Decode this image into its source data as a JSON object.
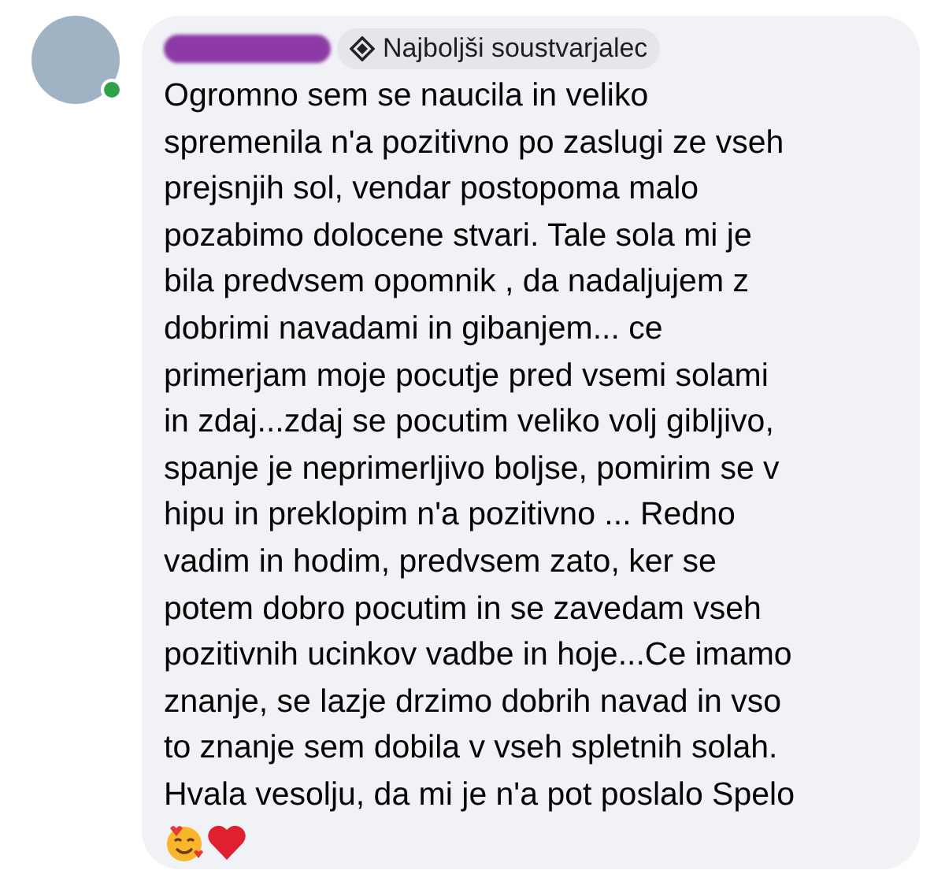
{
  "comment": {
    "author_badge": "Najboljši soustvarjalec",
    "online": true,
    "lines": [
      "Ogromno sem se naucila in veliko",
      "spremenila n'a pozitivno po zaslugi ze vseh",
      "prejsnjih sol, vendar postopoma malo",
      "pozabimo dolocene stvari. Tale sola mi je",
      "bila predvsem opomnik , da nadaljujem z",
      "dobrimi navadami in gibanjem... ce",
      "primerjam moje pocutje pred vsemi solami",
      "in zdaj...zdaj se pocutim veliko volj gibljivo,",
      "spanje je neprimerljivo boljse, pomirim se v",
      "hipu in preklopim n'a pozitivno ... Redno",
      "vadim in hodim, predvsem zato, ker se",
      "potem dobro pocutim in se zavedam vseh",
      "pozitivnih ucinkov vadbe in hoje...Ce imamo",
      "znanje, se lazje drzimo dobrih navad in vso",
      "to znanje sem dobila v vseh spletnih solah.",
      "Hvala vesolju, da mi je n'a pot poslalo Spelo"
    ]
  }
}
